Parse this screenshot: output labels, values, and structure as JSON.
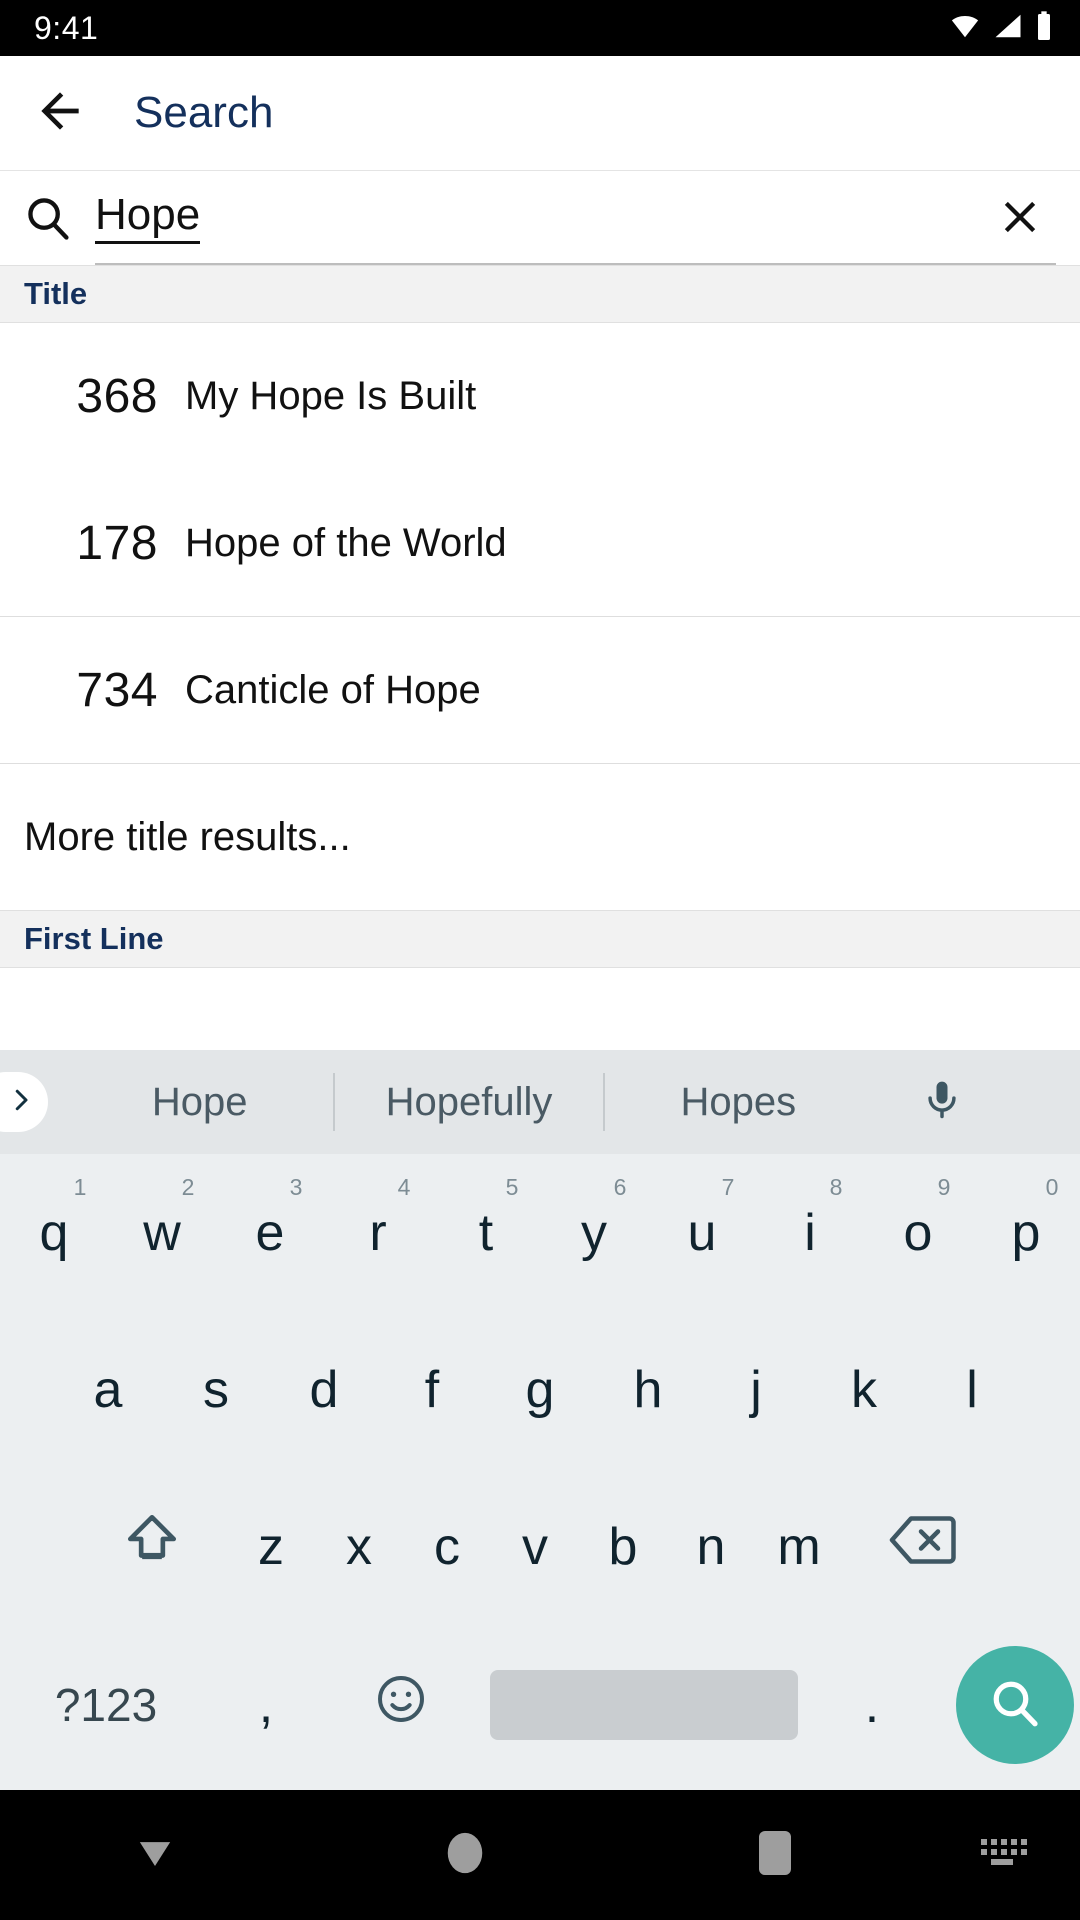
{
  "status_bar": {
    "time": "9:41",
    "icons": [
      "wifi-icon",
      "cellular-signal-icon",
      "battery-icon"
    ]
  },
  "app_bar": {
    "back_icon": "arrow-back-icon",
    "title": "Search"
  },
  "search_field": {
    "leading_icon": "search-icon",
    "value": "Hope",
    "placeholder": "Search",
    "clear_icon": "close-icon"
  },
  "results": {
    "sections": [
      {
        "header": "Title",
        "rows": [
          {
            "number": "368",
            "title": "My Hope Is Built"
          },
          {
            "number": "178",
            "title": "Hope of the World"
          },
          {
            "number": "734",
            "title": "Canticle of Hope"
          }
        ],
        "more_label": "More title results..."
      },
      {
        "header": "First Line",
        "rows": [],
        "more_label": ""
      }
    ]
  },
  "keyboard": {
    "expand_icon": "chevron-right-icon",
    "suggestions": [
      "Hope",
      "Hopefully",
      "Hopes"
    ],
    "mic_icon": "microphone-icon",
    "row1": [
      {
        "key": "q",
        "num": "1"
      },
      {
        "key": "w",
        "num": "2"
      },
      {
        "key": "e",
        "num": "3"
      },
      {
        "key": "r",
        "num": "4"
      },
      {
        "key": "t",
        "num": "5"
      },
      {
        "key": "y",
        "num": "6"
      },
      {
        "key": "u",
        "num": "7"
      },
      {
        "key": "i",
        "num": "8"
      },
      {
        "key": "o",
        "num": "9"
      },
      {
        "key": "p",
        "num": "0"
      }
    ],
    "row2": [
      "a",
      "s",
      "d",
      "f",
      "g",
      "h",
      "j",
      "k",
      "l"
    ],
    "row3": [
      "z",
      "x",
      "c",
      "v",
      "b",
      "n",
      "m"
    ],
    "shift_icon": "shift-icon",
    "backspace_icon": "backspace-icon",
    "symbols_label": "?123",
    "comma_label": ",",
    "emoji_icon": "emoji-icon",
    "space_label": "",
    "period_label": ".",
    "enter_icon": "search-icon",
    "accent_color": "#45b3a6"
  },
  "nav_bar": {
    "back_icon": "keyboard-dismiss-icon",
    "home_icon": "home-circle-icon",
    "recents_icon": "recents-square-icon",
    "keyboard_icon": "keyboard-indicator-icon"
  },
  "colors": {
    "header_text": "#14305c",
    "header_bg": "#f2f2f2",
    "keyboard_bg": "#eceff1",
    "suggestion_bg": "#e3e6e8",
    "accent": "#45b3a6"
  }
}
